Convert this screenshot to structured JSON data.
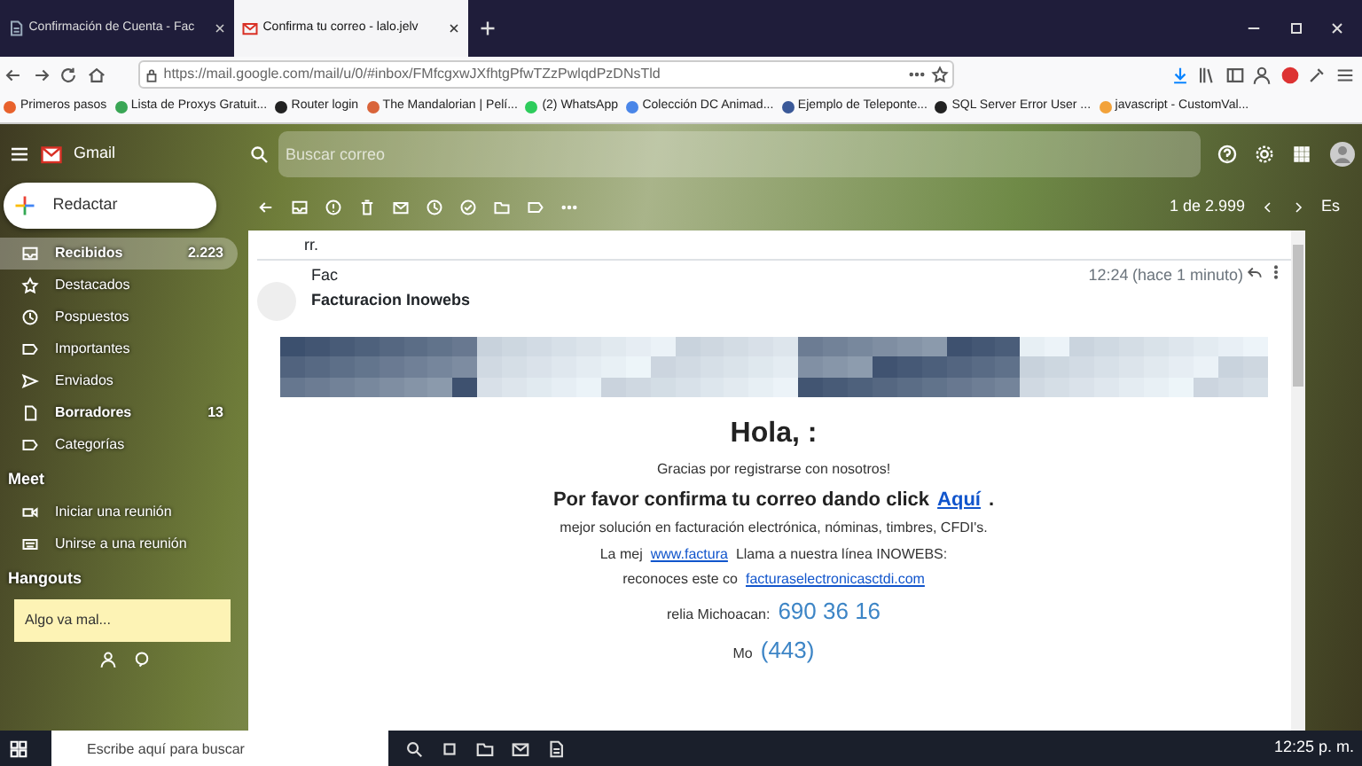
{
  "browser": {
    "tabs": [
      {
        "title": "Confirmación de Cuenta - Fac",
        "selected": false
      },
      {
        "title": "Confirma tu correo - lalo.jelv",
        "selected": true
      }
    ],
    "url": "https://mail.google.com/mail/u/0/#inbox/FMfcgxwJXfhtgPfwTZzPwlqdPzDNsTld",
    "bookmarks": [
      {
        "label": "Primeros pasos",
        "color": "#e8622c"
      },
      {
        "label": "Lista de Proxys Gratuit...",
        "color": "#3aa655"
      },
      {
        "label": "Router login",
        "color": "#222222"
      },
      {
        "label": "The Mandalorian | Pelí...",
        "color": "#d9643a"
      },
      {
        "label": "(2) WhatsApp",
        "color": "#2ecc5c"
      },
      {
        "label": "Colección DC Animad...",
        "color": "#4a86e8"
      },
      {
        "label": "Ejemplo de Teleponte...",
        "color": "#3b5998"
      },
      {
        "label": "SQL Server Error User ...",
        "color": "#222222"
      },
      {
        "label": "javascript - CustomVal...",
        "color": "#f2a23a"
      }
    ]
  },
  "gmail": {
    "logo": "Gmail",
    "search": {
      "placeholder": "Buscar correo"
    },
    "compose": "Redactar",
    "nav": [
      {
        "label": "Recibidos",
        "count": "2.223",
        "selected": true,
        "bold": true
      },
      {
        "label": "Destacados",
        "selected": false,
        "bold": false
      },
      {
        "label": "Pospuestos",
        "selected": false,
        "bold": false
      },
      {
        "label": "Importantes",
        "selected": false,
        "bold": false
      },
      {
        "label": "Enviados",
        "selected": false,
        "bold": false
      },
      {
        "label": "Borradores",
        "count": "13",
        "selected": false,
        "bold": true
      },
      {
        "label": "Categorías",
        "selected": false,
        "bold": false
      }
    ],
    "meet": {
      "title": "Meet",
      "items": [
        "Iniciar una reunión",
        "Unirse a una reunión"
      ]
    },
    "hangouts": {
      "title": "Hangouts",
      "notice": "Algo va mal..."
    },
    "toolbar": {
      "pager": "1 de 2.999",
      "language": "Es"
    },
    "email": {
      "subject": "rr.",
      "sender_short": "Fac",
      "sender": "Facturacion Inowebs",
      "time": "12:24",
      "time_ago": "(hace 1 minuto)",
      "body": [
        [
          {
            "kind": "heading",
            "text": "Hola, :"
          }
        ],
        [
          {
            "kind": "text",
            "text": "Gracias por registrarse con nosotros!"
          }
        ],
        [
          {
            "kind": "strong",
            "text": "Por favor confirma tu correo dando click"
          },
          {
            "kind": "biglink",
            "text": "Aquí"
          },
          {
            "kind": "strong",
            "text": "."
          }
        ],
        [
          {
            "kind": "text",
            "text": "mejor solución en facturación electrónica, nóminas, timbres, CFDI's."
          }
        ],
        [
          {
            "kind": "text",
            "text": "La mej"
          },
          {
            "kind": "link",
            "text": "www.factura"
          },
          {
            "kind": "text",
            "text": "Llama a nuestra línea INOWEBS:"
          }
        ],
        [
          {
            "kind": "text",
            "text": "reconoces este co"
          },
          {
            "kind": "link",
            "text": "facturaselectronicasctdi.com"
          }
        ],
        [
          {
            "kind": "text",
            "text": "relia Michoacan:"
          },
          {
            "kind": "phone",
            "text": "690 36 16"
          }
        ],
        [
          {
            "kind": "text",
            "text": "Mo"
          },
          {
            "kind": "phone",
            "text": "(443)"
          }
        ]
      ]
    }
  },
  "taskbar": {
    "search": {
      "placeholder": "Escribe aquí para buscar"
    },
    "clock": "12:25 p. m."
  }
}
